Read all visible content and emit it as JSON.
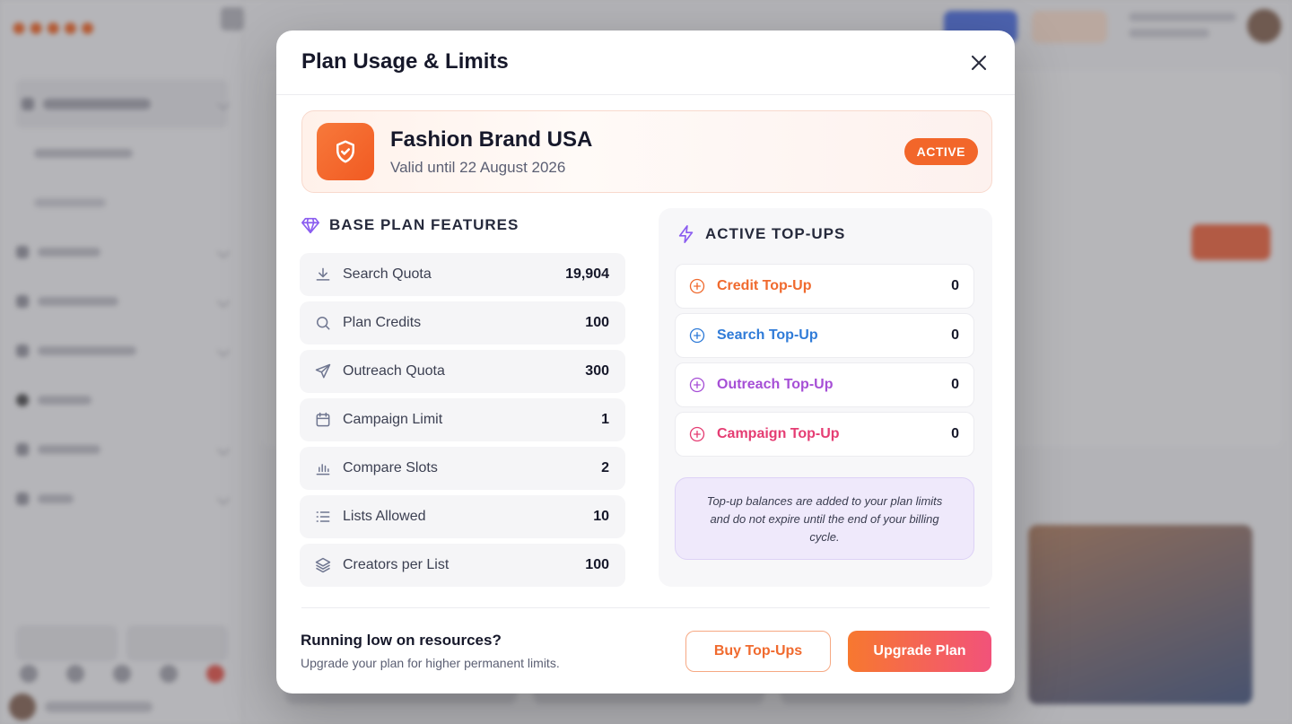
{
  "modal": {
    "title": "Plan Usage & Limits",
    "close_icon": "close-icon"
  },
  "brand": {
    "name": "Fashion Brand USA",
    "valid": "Valid until 22 August 2026",
    "badge": "ACTIVE",
    "logo_icon": "shield-check-icon"
  },
  "base_plan": {
    "title": "BASE PLAN FEATURES",
    "icon": "diamond-icon",
    "features": [
      {
        "icon": "download-icon",
        "label": "Search Quota",
        "value": "19,904"
      },
      {
        "icon": "search-icon",
        "label": "Plan Credits",
        "value": "100"
      },
      {
        "icon": "send-icon",
        "label": "Outreach Quota",
        "value": "300"
      },
      {
        "icon": "calendar-icon",
        "label": "Campaign Limit",
        "value": "1"
      },
      {
        "icon": "bar-chart-icon",
        "label": "Compare Slots",
        "value": "2"
      },
      {
        "icon": "list-icon",
        "label": "Lists Allowed",
        "value": "10"
      },
      {
        "icon": "layers-icon",
        "label": "Creators per List",
        "value": "100"
      }
    ]
  },
  "topups": {
    "title": "ACTIVE TOP-UPS",
    "icon": "lightning-icon",
    "items": [
      {
        "label": "Credit Top-Up",
        "value": "0",
        "color": "#f06a2e"
      },
      {
        "label": "Search Top-Up",
        "value": "0",
        "color": "#2f7bd8"
      },
      {
        "label": "Outreach Top-Up",
        "value": "0",
        "color": "#a64fd6"
      },
      {
        "label": "Campaign Top-Up",
        "value": "0",
        "color": "#e53d73"
      }
    ],
    "note": "Top-up balances are added to your plan limits and do not expire until the end of your billing cycle."
  },
  "footer": {
    "title": "Running low on resources?",
    "subtitle": "Upgrade your plan for higher permanent limits.",
    "buy_label": "Buy Top-Ups",
    "upgrade_label": "Upgrade Plan"
  },
  "colors": {
    "accent": "#f2662a",
    "accent_pink": "#f2527a",
    "note_bg": "#efe9fb"
  }
}
